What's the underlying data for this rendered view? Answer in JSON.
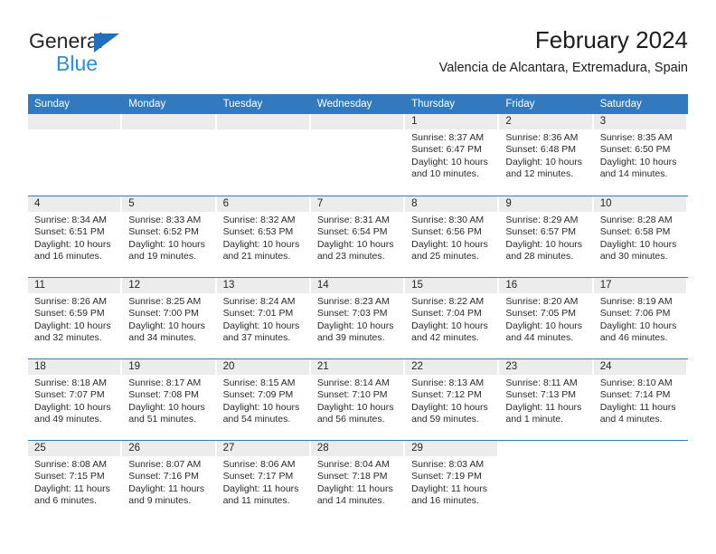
{
  "logo": {
    "word_one": "General",
    "word_two": "Blue",
    "triangle_color": "#1f6fbb",
    "word_two_color": "#2b8fd6"
  },
  "header": {
    "title": "February 2024",
    "subtitle": "Valencia de Alcantara, Extremadura, Spain"
  },
  "theme": {
    "header_blue": "#3279bd",
    "date_band_gray": "#ececec",
    "text_dark": "#242424"
  },
  "weekdays": [
    "Sunday",
    "Monday",
    "Tuesday",
    "Wednesday",
    "Thursday",
    "Friday",
    "Saturday"
  ],
  "weeks": [
    [
      {
        "day": "",
        "lines": []
      },
      {
        "day": "",
        "lines": []
      },
      {
        "day": "",
        "lines": []
      },
      {
        "day": "",
        "lines": []
      },
      {
        "day": "1",
        "lines": [
          "Sunrise: 8:37 AM",
          "Sunset: 6:47 PM",
          "Daylight: 10 hours",
          "and 10 minutes."
        ]
      },
      {
        "day": "2",
        "lines": [
          "Sunrise: 8:36 AM",
          "Sunset: 6:48 PM",
          "Daylight: 10 hours",
          "and 12 minutes."
        ]
      },
      {
        "day": "3",
        "lines": [
          "Sunrise: 8:35 AM",
          "Sunset: 6:50 PM",
          "Daylight: 10 hours",
          "and 14 minutes."
        ]
      }
    ],
    [
      {
        "day": "4",
        "lines": [
          "Sunrise: 8:34 AM",
          "Sunset: 6:51 PM",
          "Daylight: 10 hours",
          "and 16 minutes."
        ]
      },
      {
        "day": "5",
        "lines": [
          "Sunrise: 8:33 AM",
          "Sunset: 6:52 PM",
          "Daylight: 10 hours",
          "and 19 minutes."
        ]
      },
      {
        "day": "6",
        "lines": [
          "Sunrise: 8:32 AM",
          "Sunset: 6:53 PM",
          "Daylight: 10 hours",
          "and 21 minutes."
        ]
      },
      {
        "day": "7",
        "lines": [
          "Sunrise: 8:31 AM",
          "Sunset: 6:54 PM",
          "Daylight: 10 hours",
          "and 23 minutes."
        ]
      },
      {
        "day": "8",
        "lines": [
          "Sunrise: 8:30 AM",
          "Sunset: 6:56 PM",
          "Daylight: 10 hours",
          "and 25 minutes."
        ]
      },
      {
        "day": "9",
        "lines": [
          "Sunrise: 8:29 AM",
          "Sunset: 6:57 PM",
          "Daylight: 10 hours",
          "and 28 minutes."
        ]
      },
      {
        "day": "10",
        "lines": [
          "Sunrise: 8:28 AM",
          "Sunset: 6:58 PM",
          "Daylight: 10 hours",
          "and 30 minutes."
        ]
      }
    ],
    [
      {
        "day": "11",
        "lines": [
          "Sunrise: 8:26 AM",
          "Sunset: 6:59 PM",
          "Daylight: 10 hours",
          "and 32 minutes."
        ]
      },
      {
        "day": "12",
        "lines": [
          "Sunrise: 8:25 AM",
          "Sunset: 7:00 PM",
          "Daylight: 10 hours",
          "and 34 minutes."
        ]
      },
      {
        "day": "13",
        "lines": [
          "Sunrise: 8:24 AM",
          "Sunset: 7:01 PM",
          "Daylight: 10 hours",
          "and 37 minutes."
        ]
      },
      {
        "day": "14",
        "lines": [
          "Sunrise: 8:23 AM",
          "Sunset: 7:03 PM",
          "Daylight: 10 hours",
          "and 39 minutes."
        ]
      },
      {
        "day": "15",
        "lines": [
          "Sunrise: 8:22 AM",
          "Sunset: 7:04 PM",
          "Daylight: 10 hours",
          "and 42 minutes."
        ]
      },
      {
        "day": "16",
        "lines": [
          "Sunrise: 8:20 AM",
          "Sunset: 7:05 PM",
          "Daylight: 10 hours",
          "and 44 minutes."
        ]
      },
      {
        "day": "17",
        "lines": [
          "Sunrise: 8:19 AM",
          "Sunset: 7:06 PM",
          "Daylight: 10 hours",
          "and 46 minutes."
        ]
      }
    ],
    [
      {
        "day": "18",
        "lines": [
          "Sunrise: 8:18 AM",
          "Sunset: 7:07 PM",
          "Daylight: 10 hours",
          "and 49 minutes."
        ]
      },
      {
        "day": "19",
        "lines": [
          "Sunrise: 8:17 AM",
          "Sunset: 7:08 PM",
          "Daylight: 10 hours",
          "and 51 minutes."
        ]
      },
      {
        "day": "20",
        "lines": [
          "Sunrise: 8:15 AM",
          "Sunset: 7:09 PM",
          "Daylight: 10 hours",
          "and 54 minutes."
        ]
      },
      {
        "day": "21",
        "lines": [
          "Sunrise: 8:14 AM",
          "Sunset: 7:10 PM",
          "Daylight: 10 hours",
          "and 56 minutes."
        ]
      },
      {
        "day": "22",
        "lines": [
          "Sunrise: 8:13 AM",
          "Sunset: 7:12 PM",
          "Daylight: 10 hours",
          "and 59 minutes."
        ]
      },
      {
        "day": "23",
        "lines": [
          "Sunrise: 8:11 AM",
          "Sunset: 7:13 PM",
          "Daylight: 11 hours",
          "and 1 minute."
        ]
      },
      {
        "day": "24",
        "lines": [
          "Sunrise: 8:10 AM",
          "Sunset: 7:14 PM",
          "Daylight: 11 hours",
          "and 4 minutes."
        ]
      }
    ],
    [
      {
        "day": "25",
        "lines": [
          "Sunrise: 8:08 AM",
          "Sunset: 7:15 PM",
          "Daylight: 11 hours",
          "and 6 minutes."
        ]
      },
      {
        "day": "26",
        "lines": [
          "Sunrise: 8:07 AM",
          "Sunset: 7:16 PM",
          "Daylight: 11 hours",
          "and 9 minutes."
        ]
      },
      {
        "day": "27",
        "lines": [
          "Sunrise: 8:06 AM",
          "Sunset: 7:17 PM",
          "Daylight: 11 hours",
          "and 11 minutes."
        ]
      },
      {
        "day": "28",
        "lines": [
          "Sunrise: 8:04 AM",
          "Sunset: 7:18 PM",
          "Daylight: 11 hours",
          "and 14 minutes."
        ]
      },
      {
        "day": "29",
        "lines": [
          "Sunrise: 8:03 AM",
          "Sunset: 7:19 PM",
          "Daylight: 11 hours",
          "and 16 minutes."
        ]
      },
      {
        "day": "",
        "lines": []
      },
      {
        "day": "",
        "lines": []
      }
    ]
  ]
}
